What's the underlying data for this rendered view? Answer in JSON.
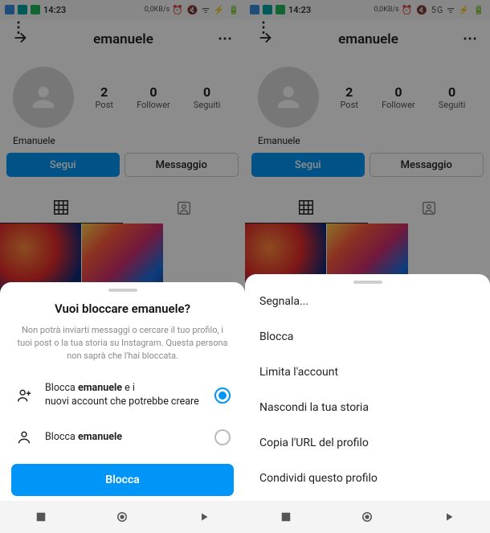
{
  "status": {
    "clock": "14:23",
    "network_kb": "0,0KB/s",
    "signal_label": "5G"
  },
  "header": {
    "title": "emanuele",
    "more_glyph": "⋮",
    "dots_glyph": "⋯"
  },
  "profile": {
    "display_name": "Emanuele",
    "stats": {
      "posts": {
        "value": "2",
        "label": "Post"
      },
      "followers": {
        "value": "0",
        "label": "Follower"
      },
      "following": {
        "value": "0",
        "label": "Seguiti"
      }
    }
  },
  "buttons": {
    "follow": "Segui",
    "message": "Messaggio"
  },
  "menu": {
    "items": [
      "Segnala...",
      "Blocca",
      "Limita l'account",
      "Nascondi la tua storia",
      "Copia l'URL del profilo",
      "Condividi questo profilo"
    ]
  },
  "block_dialog": {
    "title_prefix": "Vuoi bloccare ",
    "title_name": "emanuele",
    "title_suffix": "?",
    "description": "Non potrà inviarti messaggi o cercare il tuo profilo, i tuoi post o la tua storia su Instagram. Questa persona non saprà che l'hai bloccata.",
    "option1_prefix": "Blocca ",
    "option1_name": "emanuele",
    "option1_mid": " e i",
    "option1_line2": "nuovi account che potrebbe creare",
    "option2_prefix": "Blocca ",
    "option2_name": "emanuele",
    "confirm": "Blocca"
  }
}
